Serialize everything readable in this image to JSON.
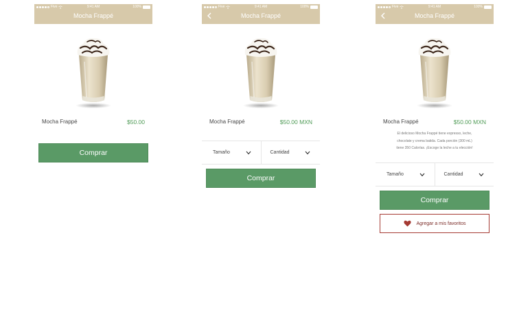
{
  "status_bar": {
    "carrier": "Five",
    "time": "9:41 AM",
    "battery": "100%"
  },
  "screens": [
    {
      "title": "Mocha Frappé",
      "product_name": "Mocha Frappé",
      "price": "$50.00",
      "buy_label": "Comprar"
    },
    {
      "title": "Mocha Frappé",
      "product_name": "Mocha Frappé",
      "price": "$50.00 MXN",
      "size_label": "Tamaño",
      "qty_label": "Cantidad",
      "buy_label": "Comprar"
    },
    {
      "title": "Mocha Frappé",
      "product_name": "Mocha Frappé",
      "price": "$50.00 MXN",
      "description": [
        "El delicioso Mocha Frappé tiene expresso, leche,",
        "chocolate y crema batida. Cada porción (300 mL)",
        "tiene 350 Calorías. ¡Escoge la leche a tu elección!"
      ],
      "size_label": "Tamaño",
      "qty_label": "Cantidad",
      "buy_label": "Comprar",
      "favorite_label": "Agregar a mis favoritos"
    }
  ],
  "colors": {
    "header": "#d7c9aa",
    "buy_button": "#5a9a66",
    "price": "#4e9a55",
    "favorite_border": "#a53a33",
    "heart": "#a53a33"
  },
  "icons": [
    "back-arrow-icon",
    "chevron-down-icon",
    "heart-icon",
    "signal-dots-icon",
    "wifi-icon",
    "battery-icon"
  ]
}
